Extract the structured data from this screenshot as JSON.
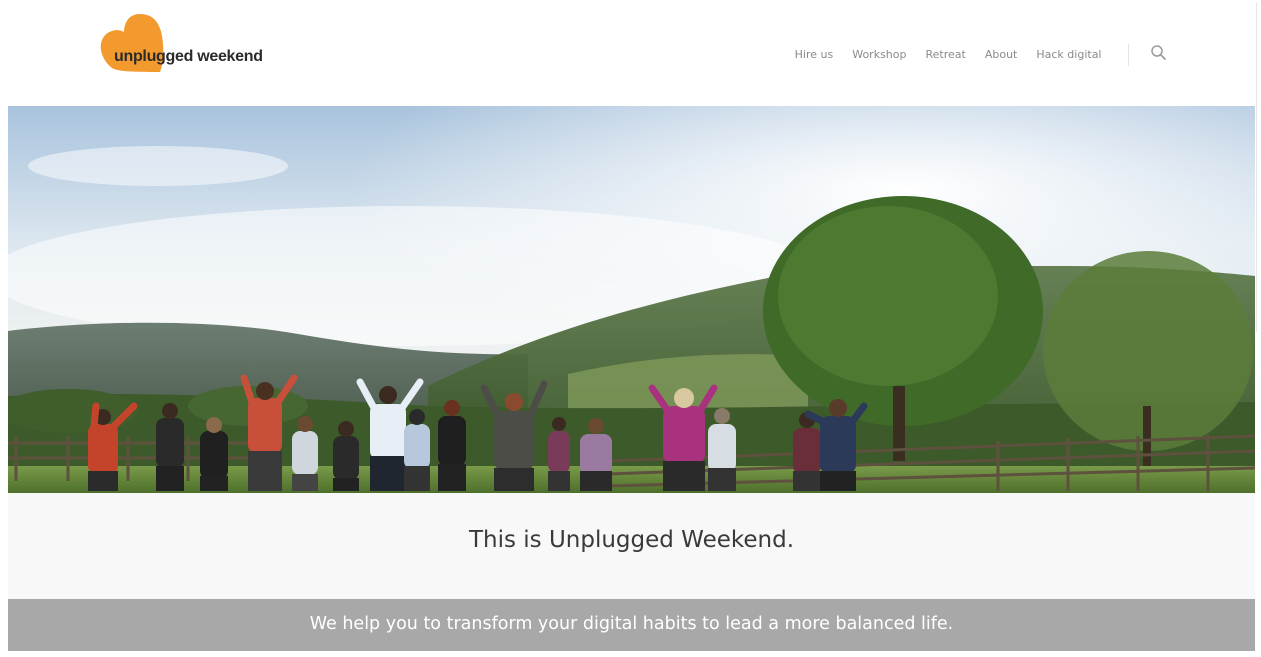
{
  "brand": {
    "logo_text": "unplugged weekend",
    "accent_color": "#f39a2e"
  },
  "nav": {
    "items": [
      {
        "label": "Hire us"
      },
      {
        "label": "Workshop"
      },
      {
        "label": "Retreat"
      },
      {
        "label": "About"
      },
      {
        "label": "Hack digital"
      }
    ],
    "search_icon": "search-icon"
  },
  "hero": {
    "image": "group-outdoor-exercise-photo"
  },
  "intro": {
    "title": "This is Unplugged Weekend."
  },
  "banner": {
    "text": "We help you to transform your digital habits to lead a more balanced life.",
    "background": "#a8a8a8"
  }
}
